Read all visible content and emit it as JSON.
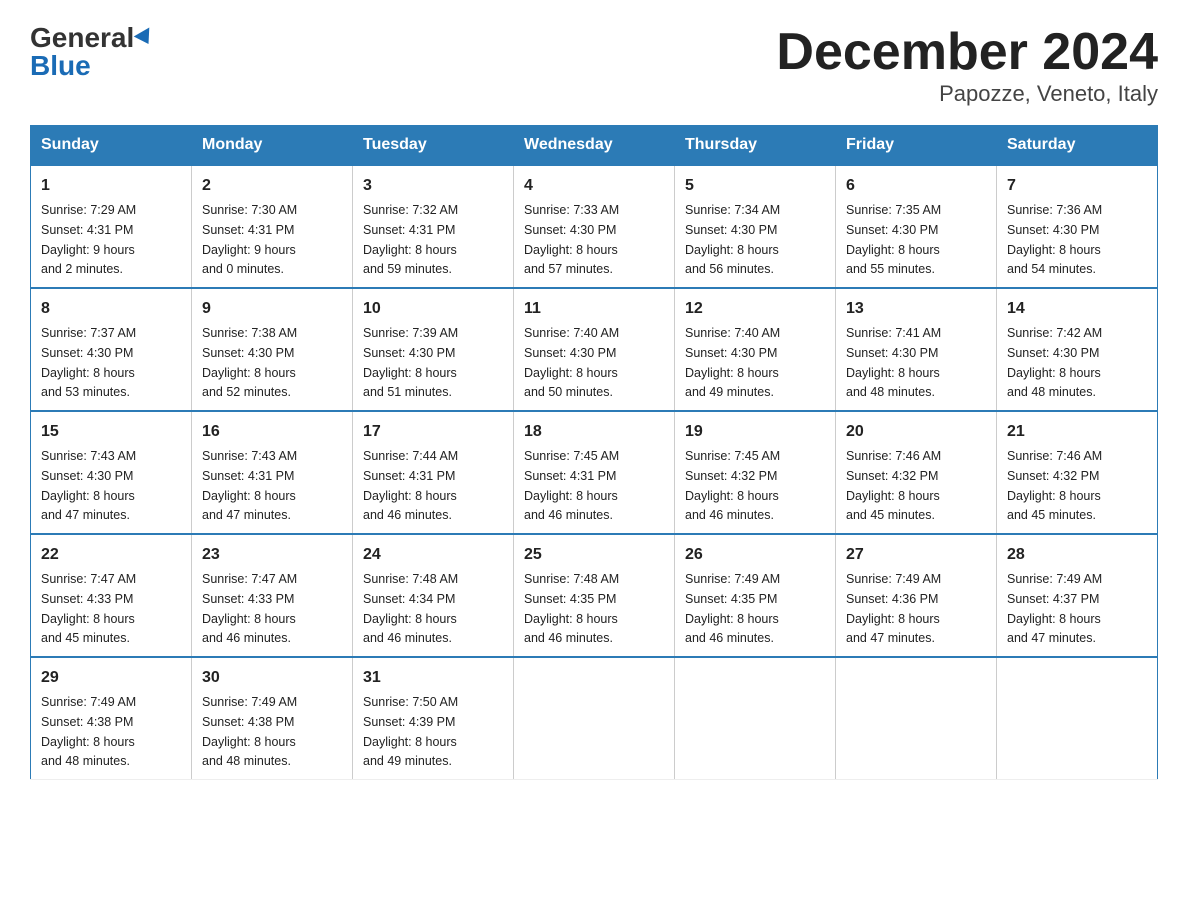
{
  "header": {
    "logo_general": "General",
    "logo_blue": "Blue",
    "title": "December 2024",
    "subtitle": "Papozze, Veneto, Italy"
  },
  "days_of_week": [
    "Sunday",
    "Monday",
    "Tuesday",
    "Wednesday",
    "Thursday",
    "Friday",
    "Saturday"
  ],
  "weeks": [
    [
      {
        "day": "1",
        "sunrise": "7:29 AM",
        "sunset": "4:31 PM",
        "daylight": "9 hours and 2 minutes."
      },
      {
        "day": "2",
        "sunrise": "7:30 AM",
        "sunset": "4:31 PM",
        "daylight": "9 hours and 0 minutes."
      },
      {
        "day": "3",
        "sunrise": "7:32 AM",
        "sunset": "4:31 PM",
        "daylight": "8 hours and 59 minutes."
      },
      {
        "day": "4",
        "sunrise": "7:33 AM",
        "sunset": "4:30 PM",
        "daylight": "8 hours and 57 minutes."
      },
      {
        "day": "5",
        "sunrise": "7:34 AM",
        "sunset": "4:30 PM",
        "daylight": "8 hours and 56 minutes."
      },
      {
        "day": "6",
        "sunrise": "7:35 AM",
        "sunset": "4:30 PM",
        "daylight": "8 hours and 55 minutes."
      },
      {
        "day": "7",
        "sunrise": "7:36 AM",
        "sunset": "4:30 PM",
        "daylight": "8 hours and 54 minutes."
      }
    ],
    [
      {
        "day": "8",
        "sunrise": "7:37 AM",
        "sunset": "4:30 PM",
        "daylight": "8 hours and 53 minutes."
      },
      {
        "day": "9",
        "sunrise": "7:38 AM",
        "sunset": "4:30 PM",
        "daylight": "8 hours and 52 minutes."
      },
      {
        "day": "10",
        "sunrise": "7:39 AM",
        "sunset": "4:30 PM",
        "daylight": "8 hours and 51 minutes."
      },
      {
        "day": "11",
        "sunrise": "7:40 AM",
        "sunset": "4:30 PM",
        "daylight": "8 hours and 50 minutes."
      },
      {
        "day": "12",
        "sunrise": "7:40 AM",
        "sunset": "4:30 PM",
        "daylight": "8 hours and 49 minutes."
      },
      {
        "day": "13",
        "sunrise": "7:41 AM",
        "sunset": "4:30 PM",
        "daylight": "8 hours and 48 minutes."
      },
      {
        "day": "14",
        "sunrise": "7:42 AM",
        "sunset": "4:30 PM",
        "daylight": "8 hours and 48 minutes."
      }
    ],
    [
      {
        "day": "15",
        "sunrise": "7:43 AM",
        "sunset": "4:30 PM",
        "daylight": "8 hours and 47 minutes."
      },
      {
        "day": "16",
        "sunrise": "7:43 AM",
        "sunset": "4:31 PM",
        "daylight": "8 hours and 47 minutes."
      },
      {
        "day": "17",
        "sunrise": "7:44 AM",
        "sunset": "4:31 PM",
        "daylight": "8 hours and 46 minutes."
      },
      {
        "day": "18",
        "sunrise": "7:45 AM",
        "sunset": "4:31 PM",
        "daylight": "8 hours and 46 minutes."
      },
      {
        "day": "19",
        "sunrise": "7:45 AM",
        "sunset": "4:32 PM",
        "daylight": "8 hours and 46 minutes."
      },
      {
        "day": "20",
        "sunrise": "7:46 AM",
        "sunset": "4:32 PM",
        "daylight": "8 hours and 45 minutes."
      },
      {
        "day": "21",
        "sunrise": "7:46 AM",
        "sunset": "4:32 PM",
        "daylight": "8 hours and 45 minutes."
      }
    ],
    [
      {
        "day": "22",
        "sunrise": "7:47 AM",
        "sunset": "4:33 PM",
        "daylight": "8 hours and 45 minutes."
      },
      {
        "day": "23",
        "sunrise": "7:47 AM",
        "sunset": "4:33 PM",
        "daylight": "8 hours and 46 minutes."
      },
      {
        "day": "24",
        "sunrise": "7:48 AM",
        "sunset": "4:34 PM",
        "daylight": "8 hours and 46 minutes."
      },
      {
        "day": "25",
        "sunrise": "7:48 AM",
        "sunset": "4:35 PM",
        "daylight": "8 hours and 46 minutes."
      },
      {
        "day": "26",
        "sunrise": "7:49 AM",
        "sunset": "4:35 PM",
        "daylight": "8 hours and 46 minutes."
      },
      {
        "day": "27",
        "sunrise": "7:49 AM",
        "sunset": "4:36 PM",
        "daylight": "8 hours and 47 minutes."
      },
      {
        "day": "28",
        "sunrise": "7:49 AM",
        "sunset": "4:37 PM",
        "daylight": "8 hours and 47 minutes."
      }
    ],
    [
      {
        "day": "29",
        "sunrise": "7:49 AM",
        "sunset": "4:38 PM",
        "daylight": "8 hours and 48 minutes."
      },
      {
        "day": "30",
        "sunrise": "7:49 AM",
        "sunset": "4:38 PM",
        "daylight": "8 hours and 48 minutes."
      },
      {
        "day": "31",
        "sunrise": "7:50 AM",
        "sunset": "4:39 PM",
        "daylight": "8 hours and 49 minutes."
      },
      null,
      null,
      null,
      null
    ]
  ],
  "labels": {
    "sunrise": "Sunrise:",
    "sunset": "Sunset:",
    "daylight": "Daylight:"
  }
}
